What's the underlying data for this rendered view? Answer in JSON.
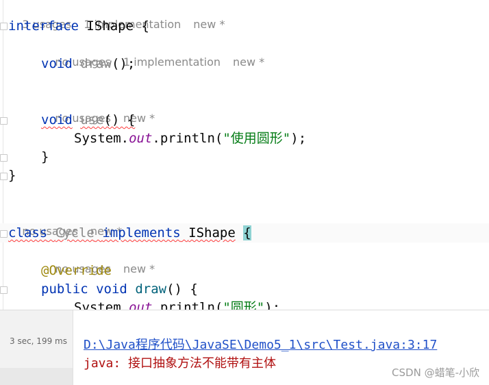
{
  "editor": {
    "hint1": {
      "usages": "3 usages",
      "impl": "1 implementation",
      "author": "new *"
    },
    "iface_kw": "interface",
    "iface_name": "IShape",
    "open_brace": "{",
    "hint2": {
      "usages": "no usages",
      "impl": "1 implementation",
      "author": "new *"
    },
    "void_kw": "void",
    "draw_name": "draw",
    "draw_tail": "();",
    "hint3": {
      "usages": "no usages",
      "author": "new *"
    },
    "use_name": "use",
    "use_tail": "() {",
    "system": "System.",
    "out": "out",
    "println_a": ".println(",
    "str_use": "\"使用圆形\"",
    "println_b": ");",
    "close_inner": "}",
    "close_outer": "}",
    "hint4": {
      "usages": "no usages",
      "author": "new *"
    },
    "class_kw": "class",
    "class_name": "Cycle",
    "implements_kw": "implements",
    "class_iface": "IShape",
    "hint5": {
      "usages": "no usages",
      "author": "new *"
    },
    "override": "@Override",
    "public_kw": "public",
    "draw_tail2": "() {",
    "str_draw": "\"圆形\""
  },
  "panel": {
    "timing": "3 sec, 199 ms",
    "error_link": "D:\\Java程序代码\\JavaSE\\Demo5_1\\src\\Test.java:3:17",
    "error_prefix": "java:",
    "error_text": "接口抽象方法不能带有主体"
  },
  "watermark": "CSDN @蜡笔-小欣"
}
